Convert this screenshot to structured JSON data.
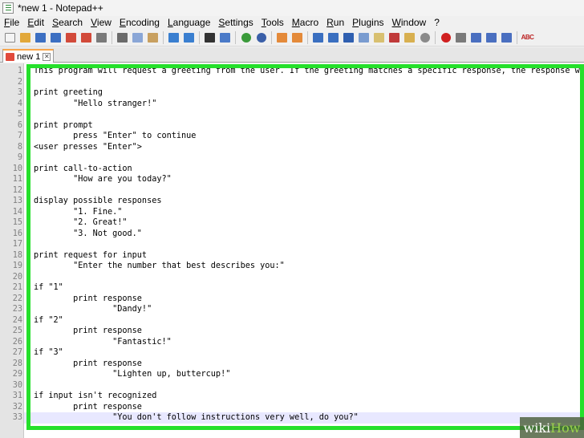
{
  "window": {
    "title": "*new 1 - Notepad++"
  },
  "menu": [
    "File",
    "Edit",
    "Search",
    "View",
    "Encoding",
    "Language",
    "Settings",
    "Tools",
    "Macro",
    "Run",
    "Plugins",
    "Window",
    "?"
  ],
  "toolbar": [
    {
      "icon": "new-file-icon",
      "color": "#f4f4f4",
      "shape": "g"
    },
    {
      "icon": "open-file-icon",
      "color": "#e2a83a",
      "shape": "g"
    },
    {
      "icon": "save-icon",
      "color": "#3c6fc2",
      "shape": "g"
    },
    {
      "icon": "save-all-icon",
      "color": "#3c6fc2",
      "shape": "g"
    },
    {
      "icon": "close-icon",
      "color": "#d24a3a",
      "shape": "g"
    },
    {
      "icon": "close-all-icon",
      "color": "#d24a3a",
      "shape": "g"
    },
    {
      "icon": "print-icon",
      "color": "#7a7a7a",
      "shape": "g"
    },
    {
      "sep": true
    },
    {
      "icon": "cut-icon",
      "color": "#6b6b6b",
      "shape": "g"
    },
    {
      "icon": "copy-icon",
      "color": "#8aa6d6",
      "shape": "g"
    },
    {
      "icon": "paste-icon",
      "color": "#c8a060",
      "shape": "g"
    },
    {
      "sep": true
    },
    {
      "icon": "undo-icon",
      "color": "#3a7fd0",
      "shape": "g"
    },
    {
      "icon": "redo-icon",
      "color": "#3a7fd0",
      "shape": "g"
    },
    {
      "sep": true
    },
    {
      "icon": "find-icon",
      "color": "#333333",
      "shape": "g"
    },
    {
      "icon": "replace-icon",
      "color": "#4a7ac8",
      "shape": "g"
    },
    {
      "sep": true
    },
    {
      "icon": "zoom-in-icon",
      "color": "#3a9a3a",
      "shape": "c"
    },
    {
      "icon": "zoom-out-icon",
      "color": "#3a5fa8",
      "shape": "c"
    },
    {
      "sep": true
    },
    {
      "icon": "sync-vertical-icon",
      "color": "#e48a3a",
      "shape": "g"
    },
    {
      "icon": "sync-horizontal-icon",
      "color": "#e48a3a",
      "shape": "g"
    },
    {
      "sep": true
    },
    {
      "icon": "word-wrap-icon",
      "color": "#3a6fc0",
      "shape": "g"
    },
    {
      "icon": "show-all-characters-icon",
      "color": "#3a6fc0",
      "shape": "g"
    },
    {
      "icon": "indent-guide-icon",
      "color": "#2f5fb0",
      "shape": "g"
    },
    {
      "icon": "language-icon",
      "color": "#7a9cd0",
      "shape": "g"
    },
    {
      "icon": "document-map-icon",
      "color": "#d8c070",
      "shape": "g"
    },
    {
      "icon": "function-list-icon",
      "color": "#c03a3a",
      "shape": "g"
    },
    {
      "icon": "folder-as-workspace-icon",
      "color": "#d8b050",
      "shape": "g"
    },
    {
      "icon": "monitoring-icon",
      "color": "#8a8a8a",
      "shape": "c"
    },
    {
      "sep": true
    },
    {
      "icon": "record-macro-icon",
      "color": "#d02020",
      "shape": "c"
    },
    {
      "icon": "stop-recording-icon",
      "color": "#7a7a7a",
      "shape": "g"
    },
    {
      "icon": "playback-macro-icon",
      "color": "#4a6fc0",
      "shape": "g"
    },
    {
      "icon": "run-macro-multiple-icon",
      "color": "#4a6fc0",
      "shape": "g"
    },
    {
      "icon": "save-macro-icon",
      "color": "#4a6fc0",
      "shape": "g"
    },
    {
      "sep": true
    },
    {
      "icon": "spell-check-icon",
      "label": "ABC",
      "shape": "t"
    }
  ],
  "tab": {
    "label": "new 1",
    "close": "✕"
  },
  "editor": {
    "current_line": 33,
    "lines": [
      "This program will request a greeting from the user. If the greeting matches a specific response, the response will",
      "",
      "print greeting",
      "        \"Hello stranger!\"",
      "",
      "print prompt",
      "        press \"Enter\" to continue",
      "<user presses \"Enter\">",
      "",
      "print call-to-action",
      "        \"How are you today?\"",
      "",
      "display possible responses",
      "        \"1. Fine.\"",
      "        \"2. Great!\"",
      "        \"3. Not good.\"",
      "",
      "print request for input",
      "        \"Enter the number that best describes you:\"",
      "",
      "if \"1\"",
      "        print response",
      "                \"Dandy!\"",
      "if \"2\"",
      "        print response",
      "                \"Fantastic!\"",
      "if \"3\"",
      "        print response",
      "                \"Lighten up, buttercup!\"",
      "",
      "if input isn't recognized",
      "        print response",
      "                \"You don't follow instructions very well, do you?\""
    ]
  },
  "watermark": {
    "prefix": "wiki",
    "suffix": "How"
  },
  "colors": {
    "highlight": "#25e02b",
    "tab_accent": "#f9a64a"
  }
}
